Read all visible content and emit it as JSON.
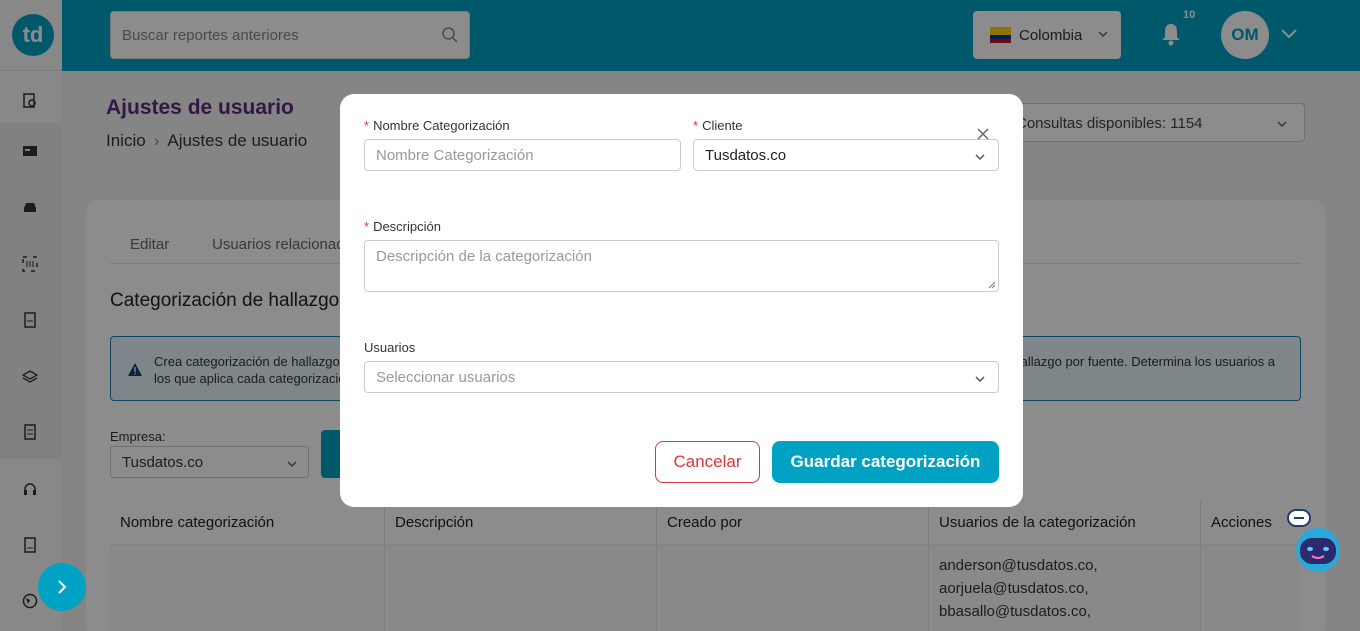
{
  "header": {
    "logo": "td",
    "search_placeholder": "Buscar reportes anteriores",
    "country": "Colombia",
    "notifications_count": "10",
    "user_initials": "OM"
  },
  "page": {
    "title": "Ajustes de usuario",
    "breadcrumb": [
      "Inicio",
      "Ajustes de usuario"
    ],
    "consultas": "Consultas disponibles: 1154",
    "tabs": [
      "Editar",
      "Usuarios relacionados"
    ],
    "section_title": "Categorización de hallazgos",
    "alert": {
      "line1": "Crea categorización de hallazgos",
      "line2": "los que aplica cada categorización",
      "line1_end": "hallazgo por fuente. Determina los usuarios a"
    },
    "empresa_label": "Empresa:",
    "empresa_value": "Tusdatos.co",
    "table": {
      "headers": [
        "Nombre categorización",
        "Descripción",
        "Creado por",
        "Usuarios de la categorización",
        "Acciones"
      ],
      "users": [
        "anderson@tusdatos.co,",
        "aorjuela@tusdatos.co,",
        "bbasallo@tusdatos.co,"
      ]
    }
  },
  "modal": {
    "nombre_label": "Nombre Categorización",
    "nombre_placeholder": "Nombre Categorización",
    "cliente_label": "Cliente",
    "cliente_value": "Tusdatos.co",
    "descripcion_label": "Descripción",
    "descripcion_placeholder": "Descripción de la categorización",
    "usuarios_label": "Usuarios",
    "usuarios_placeholder": "Seleccionar usuarios",
    "cancel_label": "Cancelar",
    "save_label": "Guardar categorización"
  },
  "colors": {
    "primary": "#00a2c3",
    "title": "#5e2a7e",
    "danger": "#d9363e"
  }
}
